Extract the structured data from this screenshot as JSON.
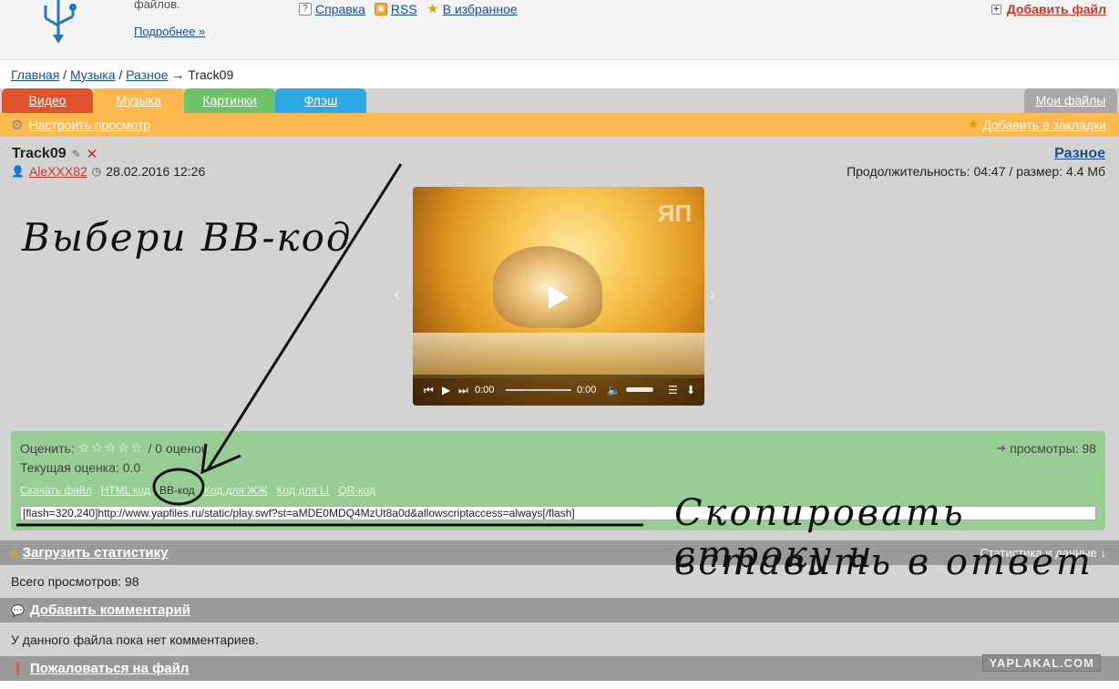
{
  "header": {
    "intro_text": "файлов.",
    "more_link": "Подробнее »",
    "links": [
      {
        "label": "Справка",
        "icon": "help-icon"
      },
      {
        "label": "RSS",
        "icon": "rss-icon"
      },
      {
        "label": "В избранное",
        "icon": "star-icon"
      }
    ],
    "add_file": "Добавить файл"
  },
  "breadcrumb": {
    "home": "Главная",
    "sep1": " / ",
    "music": "Музыка",
    "sep2": " / ",
    "misc": "Разное",
    "arrow": " → ",
    "current": "Track09"
  },
  "tabs": {
    "video": "Видео",
    "music": "Музыка",
    "pictures": "Картинки",
    "flash": "Флэш",
    "my_files": "Мои файлы"
  },
  "toolbar": {
    "settings": "Настроить просмотр",
    "bookmarks": "Добавить в закладки"
  },
  "file": {
    "title": "Track09",
    "user": "AleXXX82",
    "date": "28.02.2016 12:26",
    "category": "Разное",
    "duration": "Продолжительность: 04:47 / размер: 4.4 Мб"
  },
  "player": {
    "time_current": "0:00",
    "time_total": "0:00",
    "logo": "ЯП"
  },
  "rating": {
    "label": "Оценить:",
    "stars": "☆☆☆☆☆",
    "count": "/ 0 оценок",
    "current": "Текущая оценка: 0.0",
    "views": "просмотры: 98"
  },
  "code_links": [
    "Скачать файл",
    "HTML код",
    "BB-код",
    "Код для ЖЖ",
    "Код для LI",
    "QR-код"
  ],
  "code_value": "[flash=320,240]http://www.yapfiles.ru/static/play.swf?st=aMDE0MDQ4MzUt8a0d&allowscriptaccess=always[/flash]",
  "sections": {
    "stats": "Загрузить статистику",
    "stats_right": "Статистика и данные ↓",
    "stats_text": "Всего просмотров: 98",
    "comment": "Добавить комментарий",
    "comment_text": "У данного файла пока нет комментариев.",
    "report": "Пожаловаться на файл"
  },
  "annotations": {
    "left": "Выбери BB-код",
    "right_line1": "Скопировать строку и",
    "right_line2": "вставить в ответ"
  },
  "watermark": "YAPLAKAL.COM"
}
